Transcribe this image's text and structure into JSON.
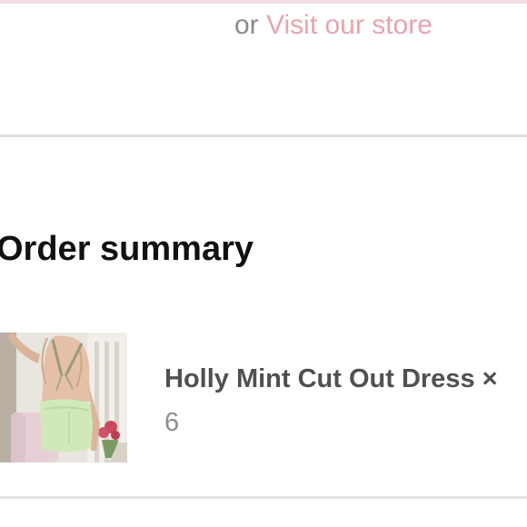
{
  "store_line": {
    "prefix": "or",
    "link_label": "Visit our store"
  },
  "order_summary": {
    "title": "Order summary",
    "items": [
      {
        "name": "Holly Mint Cut Out Dress",
        "multiplier": "×",
        "quantity": "6",
        "image_alt": "Holly Mint Cut Out Dress"
      }
    ]
  },
  "colors": {
    "link": "#e8a4ae",
    "muted_text": "#8a8a8a",
    "heading": "#111111",
    "product_name": "#505050",
    "divider": "#dedede"
  }
}
